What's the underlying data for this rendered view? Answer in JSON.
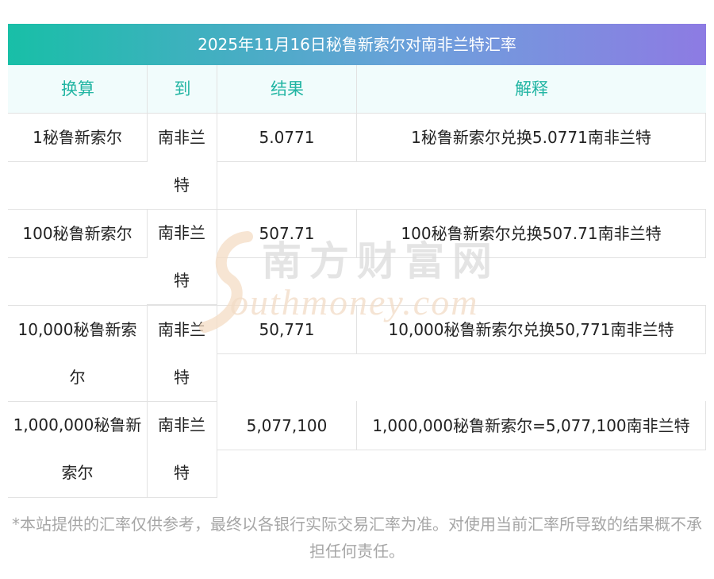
{
  "title": "2025年11月16日秘鲁新索尔对南非兰特汇率",
  "headers": {
    "convert": "换算",
    "to": "到",
    "result": "结果",
    "explain": "解释"
  },
  "rows": [
    {
      "from_line1": "1秘鲁新索尔",
      "from_line2": "",
      "to_line1": "南非兰",
      "to_line2": "特",
      "result": "5.0771",
      "explain": "1秘鲁新索尔兑换5.0771南非兰特"
    },
    {
      "from_line1": "100秘鲁新索尔",
      "from_line2": "",
      "to_line1": "南非兰",
      "to_line2": "特",
      "result": "507.71",
      "explain": "100秘鲁新索尔兑换507.71南非兰特"
    },
    {
      "from_line1": "10,000秘鲁新索",
      "from_line2": "尔",
      "to_line1": "南非兰",
      "to_line2": "特",
      "result": "50,771",
      "explain": "10,000秘鲁新索尔兑换50,771南非兰特"
    },
    {
      "from_line1": "1,000,000秘鲁新",
      "from_line2": "索尔",
      "to_line1": "南非兰",
      "to_line2": "特",
      "result": "5,077,100",
      "explain": "1,000,000秘鲁新索尔=5,077,100南非兰特"
    }
  ],
  "watermark": {
    "cn": "南方财富网",
    "en": "outhmoney.com",
    "s": "S"
  },
  "footnote": "*本站提供的汇率仅供参考，最终以各银行实际交易汇率为准。对使用当前汇率所导致的结果概不承担任何责任。",
  "colors": {
    "header_text": "#22b5a3",
    "header_bg": "#f1fcfc",
    "title_gradient_start": "#18bfa7",
    "title_gradient_end": "#8d7be3",
    "border": "#e2e2e2",
    "footnote_text": "#a6a6a6"
  }
}
